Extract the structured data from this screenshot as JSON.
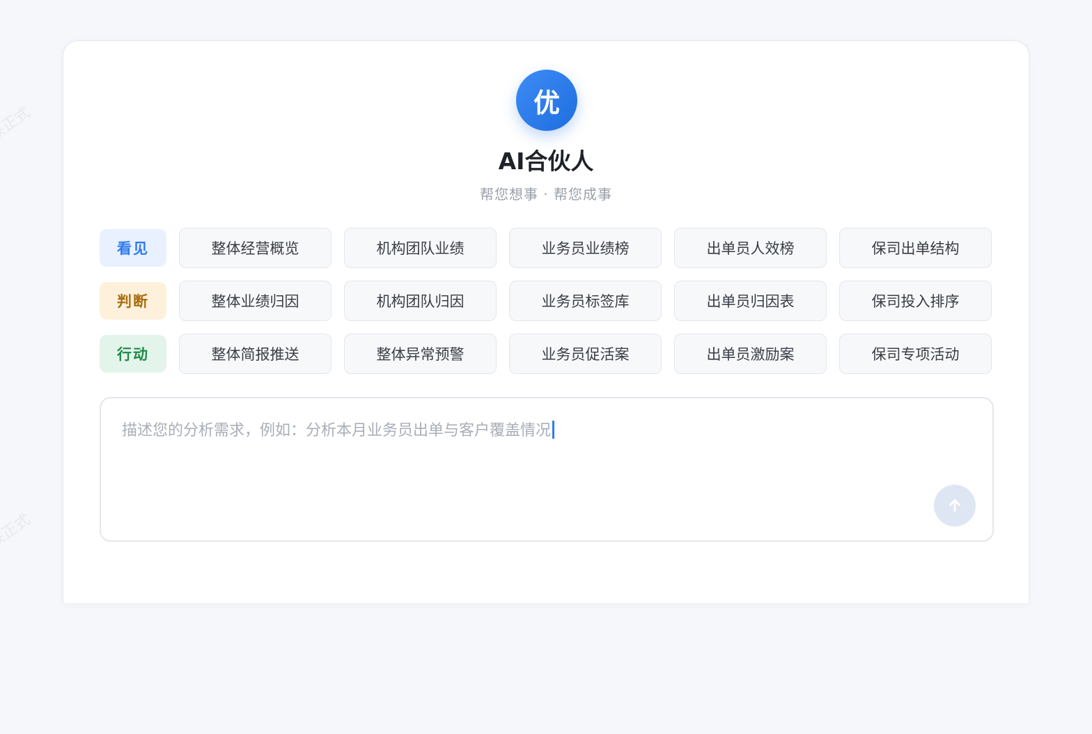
{
  "header": {
    "logo_char": "优",
    "title": "AI合伙人",
    "subtitle": "帮您想事 · 帮您成事"
  },
  "watermark": "联正式",
  "rows": [
    {
      "tag": "看见",
      "chips": [
        "整体经营概览",
        "机构团队业绩",
        "业务员业绩榜",
        "出单员人效榜",
        "保司出单结构"
      ]
    },
    {
      "tag": "判断",
      "chips": [
        "整体业绩归因",
        "机构团队归因",
        "业务员标签库",
        "出单员归因表",
        "保司投入排序"
      ]
    },
    {
      "tag": "行动",
      "chips": [
        "整体简报推送",
        "整体异常预警",
        "业务员促活案",
        "出单员激励案",
        "保司专项活动"
      ]
    }
  ],
  "input": {
    "placeholder": "描述您的分析需求，例如：分析本月业务员出单与客户覆盖情况"
  },
  "icons": {
    "send": "arrow-up-icon"
  },
  "colors": {
    "accent": "#2f7cf0",
    "see": "#2f7cf0",
    "judge": "#a86d10",
    "act": "#1f8a4c"
  }
}
